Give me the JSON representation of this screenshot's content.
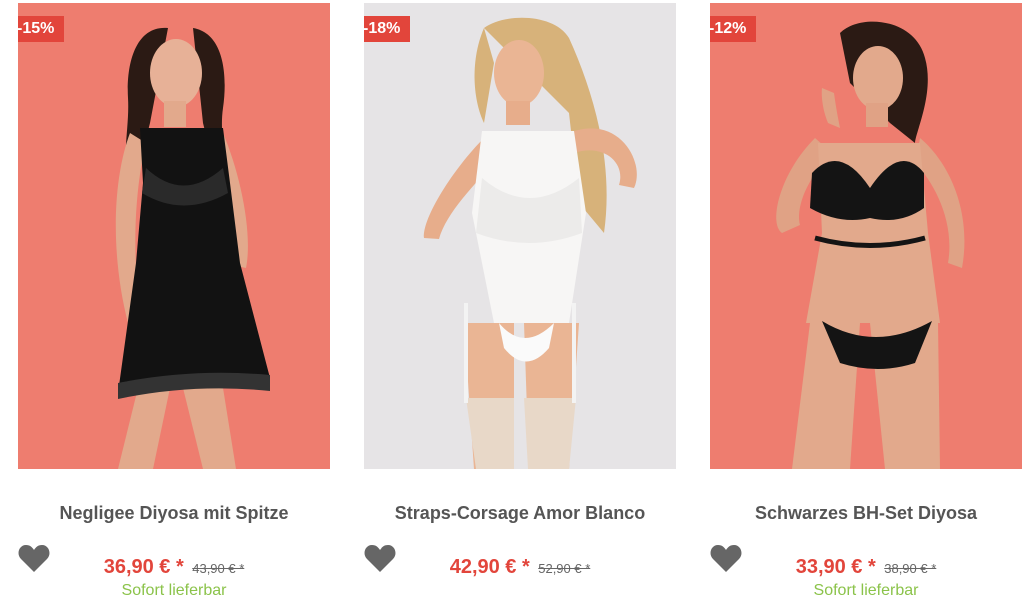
{
  "products": [
    {
      "badge": "-15%",
      "title": "Negligee Diyosa mit Spitze",
      "price": "36,90 € *",
      "old_price": "43,90 € *",
      "availability": "Sofort lieferbar",
      "background": "#ee7d6f",
      "garment": "black"
    },
    {
      "badge": "-18%",
      "title": "Straps-Corsage Amor Blanco",
      "price": "42,90 € *",
      "old_price": "52,90 € *",
      "availability": "",
      "background": "#e6e4e6",
      "garment": "white"
    },
    {
      "badge": "-12%",
      "title": "Schwarzes BH-Set Diyosa",
      "price": "33,90 € *",
      "old_price": "38,90 € *",
      "availability": "Sofort lieferbar",
      "background": "#ee7d6f",
      "garment": "black"
    }
  ],
  "colors": {
    "accent": "#e2453b",
    "stock": "#8bc34a",
    "title": "#555555",
    "wishlist_icon": "#666666"
  },
  "icons": {
    "wishlist": "heart-icon"
  }
}
